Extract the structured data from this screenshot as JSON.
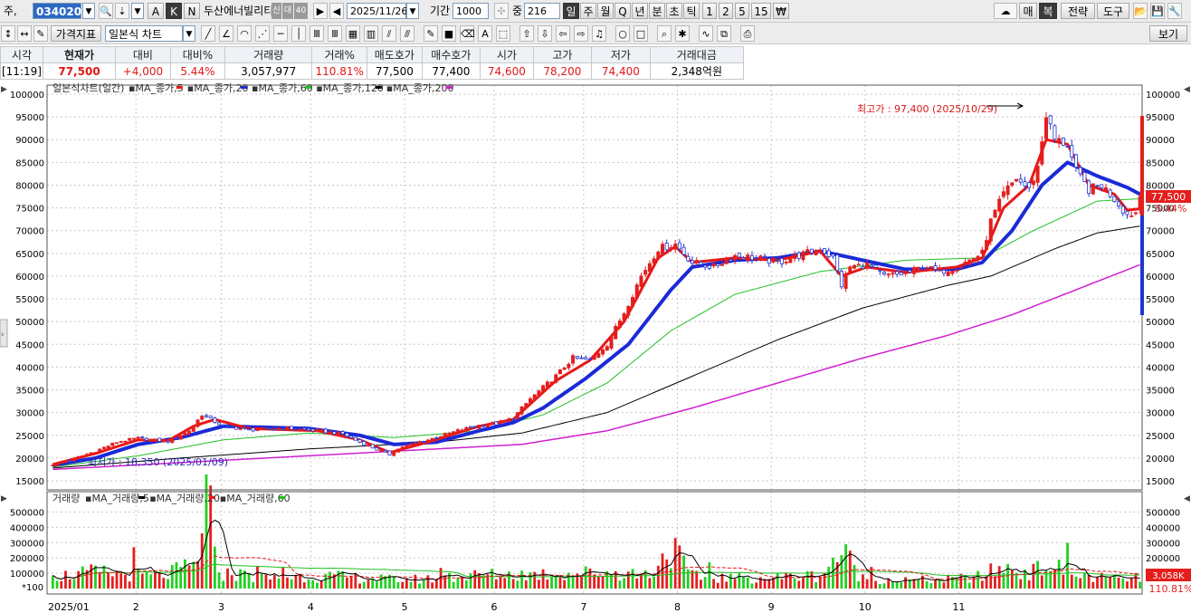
{
  "toolbar1": {
    "code_prefix": "주,",
    "stock_code": "034020",
    "btn_a": "A",
    "btn_k": "K",
    "btn_n": "N",
    "stock_name": "두산에너빌리티",
    "badge1": "신",
    "badge2": "대",
    "badge3": "40",
    "date": "2025/11/26",
    "period_label": "기간",
    "period_value": "1000",
    "mid_label": "중",
    "mid_value": "216",
    "tf_day": "일",
    "tf_week": "주",
    "tf_month": "월",
    "tf_q": "Q",
    "tf_year": "년",
    "tf_min": "분",
    "tf_sec": "초",
    "tf_tick": "틱",
    "n1": "1",
    "n2": "2",
    "n5": "5",
    "n15": "15",
    "currency": "₩",
    "right_mae": "매",
    "right_bok": "복",
    "right_strategy": "전략",
    "right_tools": "도구"
  },
  "toolbar2": {
    "price_indicator": "가격지표",
    "chart_type": "일본식 차트",
    "view": "보기"
  },
  "quote": {
    "headers": [
      "시각",
      "현재가",
      "대비",
      "대비%",
      "거래량",
      "거래%",
      "매도호가",
      "매수호가",
      "시가",
      "고가",
      "저가",
      "거래대금"
    ],
    "values": [
      "[11:19]",
      "77,500",
      "+4,000",
      "5.44%",
      "3,057,977",
      "110.81%",
      "77,500",
      "77,400",
      "74,600",
      "78,200",
      "74,400",
      "2,348억원"
    ]
  },
  "price_panel": {
    "title": "일본식차트(일간)",
    "legends": [
      {
        "label": "MA_종가,5",
        "color": "#e81818"
      },
      {
        "label": "MA_종가,20",
        "color": "#1a2ad8"
      },
      {
        "label": "MA_종가,60",
        "color": "#22c022"
      },
      {
        "label": "MA_종가,120",
        "color": "#000000"
      },
      {
        "label": "MA_종가,200",
        "color": "#d020d0"
      }
    ],
    "high_note": "최고가 : 97,400 (2025/10/29)",
    "low_note": "최저가 : 18,350 (2025/01/09)",
    "current_price_tag": "77,500",
    "current_change_tag": "5.44%"
  },
  "volume_panel": {
    "title": "거래량",
    "legends": [
      {
        "label": "MA_거래량,5",
        "color": "#000000"
      },
      {
        "label": "MA_거래량,20",
        "color": "#e81818"
      },
      {
        "label": "MA_거래량,60",
        "color": "#22c022"
      }
    ],
    "unit": "*100",
    "current_volume_tag": "3,058K",
    "current_ratio_tag": "110.81%"
  },
  "chart_data": {
    "type": "candlestick",
    "price_axis": {
      "min": 15000,
      "max": 100000,
      "step": 5000,
      "labels": [
        "15000",
        "20000",
        "25000",
        "30000",
        "35000",
        "40000",
        "45000",
        "50000",
        "55000",
        "60000",
        "65000",
        "70000",
        "75000",
        "80000",
        "85000",
        "90000",
        "95000",
        "100000"
      ]
    },
    "volume_axis": {
      "min": 0,
      "max": 550000,
      "labels": [
        "100000",
        "200000",
        "300000",
        "400000",
        "500000"
      ]
    },
    "month_labels": [
      "2025/01",
      "2",
      "3",
      "4",
      "5",
      "6",
      "7",
      "8",
      "9",
      "10",
      "11"
    ],
    "close_anchors": [
      [
        0,
        18600
      ],
      [
        4,
        19500
      ],
      [
        10,
        21500
      ],
      [
        15,
        23500
      ],
      [
        20,
        24400
      ],
      [
        27,
        23600
      ],
      [
        32,
        26000
      ],
      [
        35,
        29500
      ],
      [
        40,
        27000
      ],
      [
        46,
        26200
      ],
      [
        55,
        26500
      ],
      [
        62,
        26000
      ],
      [
        68,
        25300
      ],
      [
        72,
        23500
      ],
      [
        77,
        21500
      ],
      [
        79,
        20800
      ],
      [
        82,
        22500
      ],
      [
        88,
        24000
      ],
      [
        95,
        26000
      ],
      [
        100,
        27200
      ],
      [
        104,
        27500
      ],
      [
        108,
        28800
      ],
      [
        112,
        33000
      ],
      [
        118,
        38000
      ],
      [
        122,
        42000
      ],
      [
        126,
        41500
      ],
      [
        130,
        45000
      ],
      [
        134,
        52000
      ],
      [
        138,
        60000
      ],
      [
        142,
        66000
      ],
      [
        146,
        67000
      ],
      [
        150,
        63000
      ],
      [
        155,
        62000
      ],
      [
        160,
        64500
      ],
      [
        165,
        64000
      ],
      [
        170,
        63000
      ],
      [
        175,
        64500
      ],
      [
        180,
        66000
      ],
      [
        183,
        64000
      ],
      [
        185,
        58000
      ],
      [
        187,
        62000
      ],
      [
        191,
        62500
      ],
      [
        195,
        60000
      ],
      [
        200,
        60500
      ],
      [
        204,
        62000
      ],
      [
        208,
        61000
      ],
      [
        212,
        62000
      ],
      [
        215,
        63500
      ],
      [
        218,
        65000
      ],
      [
        220,
        72000
      ],
      [
        223,
        78000
      ],
      [
        226,
        81500
      ],
      [
        229,
        79000
      ],
      [
        231,
        84000
      ],
      [
        233,
        95500
      ],
      [
        235,
        90000
      ],
      [
        238,
        89000
      ],
      [
        240,
        83000
      ],
      [
        243,
        79000
      ],
      [
        246,
        80000
      ],
      [
        249,
        77000
      ],
      [
        252,
        73500
      ],
      [
        254,
        74000
      ],
      [
        255,
        77500
      ]
    ],
    "ma_anchors": {
      "MA_종가,5": [
        [
          0,
          18600
        ],
        [
          10,
          21000
        ],
        [
          20,
          24000
        ],
        [
          27,
          23800
        ],
        [
          33,
          27000
        ],
        [
          38,
          28500
        ],
        [
          46,
          26500
        ],
        [
          62,
          26000
        ],
        [
          72,
          24000
        ],
        [
          79,
          21200
        ],
        [
          88,
          23500
        ],
        [
          100,
          27000
        ],
        [
          108,
          28500
        ],
        [
          118,
          37000
        ],
        [
          126,
          41500
        ],
        [
          134,
          50000
        ],
        [
          142,
          64000
        ],
        [
          146,
          66500
        ],
        [
          150,
          63000
        ],
        [
          160,
          64000
        ],
        [
          170,
          63500
        ],
        [
          180,
          65500
        ],
        [
          185,
          60000
        ],
        [
          191,
          62000
        ],
        [
          200,
          60800
        ],
        [
          212,
          62000
        ],
        [
          218,
          64000
        ],
        [
          223,
          75000
        ],
        [
          229,
          80000
        ],
        [
          233,
          90000
        ],
        [
          238,
          89000
        ],
        [
          243,
          80000
        ],
        [
          249,
          78000
        ],
        [
          252,
          74500
        ],
        [
          255,
          74800
        ]
      ],
      "MA_종가,20": [
        [
          0,
          18400
        ],
        [
          10,
          20000
        ],
        [
          20,
          23000
        ],
        [
          30,
          24500
        ],
        [
          40,
          27000
        ],
        [
          60,
          26500
        ],
        [
          72,
          25000
        ],
        [
          80,
          23000
        ],
        [
          90,
          23500
        ],
        [
          100,
          26000
        ],
        [
          108,
          27800
        ],
        [
          115,
          31000
        ],
        [
          125,
          37500
        ],
        [
          135,
          45000
        ],
        [
          145,
          57000
        ],
        [
          150,
          62000
        ],
        [
          160,
          63500
        ],
        [
          170,
          64000
        ],
        [
          180,
          65500
        ],
        [
          190,
          63500
        ],
        [
          200,
          61500
        ],
        [
          212,
          61500
        ],
        [
          218,
          63000
        ],
        [
          225,
          70000
        ],
        [
          232,
          80000
        ],
        [
          238,
          85000
        ],
        [
          245,
          82000
        ],
        [
          252,
          79500
        ],
        [
          255,
          78000
        ]
      ],
      "MA_종가,60": [
        [
          0,
          18000
        ],
        [
          20,
          20500
        ],
        [
          40,
          24000
        ],
        [
          60,
          25500
        ],
        [
          80,
          24500
        ],
        [
          100,
          26000
        ],
        [
          115,
          29500
        ],
        [
          130,
          36500
        ],
        [
          145,
          48000
        ],
        [
          160,
          56000
        ],
        [
          180,
          61000
        ],
        [
          200,
          63500
        ],
        [
          218,
          64000
        ],
        [
          230,
          70000
        ],
        [
          245,
          76500
        ],
        [
          255,
          77000
        ]
      ],
      "MA_종가,120": [
        [
          0,
          17800
        ],
        [
          30,
          20000
        ],
        [
          60,
          22000
        ],
        [
          90,
          23500
        ],
        [
          110,
          25500
        ],
        [
          130,
          30000
        ],
        [
          150,
          38000
        ],
        [
          170,
          46000
        ],
        [
          190,
          53000
        ],
        [
          210,
          58000
        ],
        [
          220,
          60000
        ],
        [
          235,
          66000
        ],
        [
          245,
          69500
        ],
        [
          255,
          71000
        ]
      ],
      "MA_종가,200": [
        [
          0,
          17500
        ],
        [
          40,
          19500
        ],
        [
          80,
          21500
        ],
        [
          110,
          23000
        ],
        [
          130,
          26000
        ],
        [
          150,
          31000
        ],
        [
          170,
          36500
        ],
        [
          190,
          42000
        ],
        [
          210,
          47000
        ],
        [
          225,
          51500
        ],
        [
          240,
          57000
        ],
        [
          255,
          62500
        ]
      ]
    },
    "volume_anchors": [
      [
        0,
        80000
      ],
      [
        10,
        110000
      ],
      [
        20,
        90000
      ],
      [
        25,
        80000
      ],
      [
        34,
        160000
      ],
      [
        35,
        520000
      ],
      [
        36,
        280000
      ],
      [
        40,
        100000
      ],
      [
        50,
        70000
      ],
      [
        60,
        85000
      ],
      [
        70,
        75000
      ],
      [
        80,
        60000
      ],
      [
        90,
        65000
      ],
      [
        100,
        90000
      ],
      [
        110,
        95000
      ],
      [
        120,
        100000
      ],
      [
        130,
        110000
      ],
      [
        140,
        95000
      ],
      [
        145,
        280000
      ],
      [
        150,
        80000
      ],
      [
        160,
        70000
      ],
      [
        170,
        75000
      ],
      [
        180,
        90000
      ],
      [
        185,
        250000
      ],
      [
        190,
        70000
      ],
      [
        200,
        55000
      ],
      [
        210,
        60000
      ],
      [
        218,
        80000
      ],
      [
        222,
        140000
      ],
      [
        230,
        110000
      ],
      [
        233,
        160000
      ],
      [
        240,
        90000
      ],
      [
        250,
        60000
      ],
      [
        255,
        70000
      ]
    ],
    "high": {
      "value": 97400,
      "date": "2025/10/29"
    },
    "low": {
      "value": 18350,
      "date": "2025/01/09"
    }
  }
}
